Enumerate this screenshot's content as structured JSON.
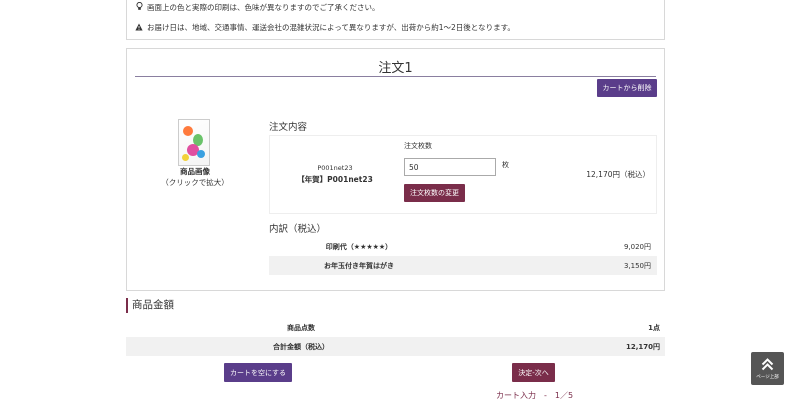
{
  "notices": [
    {
      "icon": "lightbulb-icon",
      "glyph": "💡",
      "text": "画面上の色と実際の印刷は、色味が異なりますのでご了承ください。"
    },
    {
      "icon": "warning-icon",
      "glyph": "▲",
      "text": "お届け日は、地域、交通事情、運送会社の混雑状況によって異なりますが、出荷から約1～2日後となります。"
    }
  ],
  "order": {
    "title": "注文1",
    "remove_button": "カートから削除",
    "image_caption": "商品画像",
    "image_zoom_hint": "（クリックで拡大）",
    "content_heading": "注文内容",
    "product_code": "P001net23",
    "product_name": "【年賀】P001net23",
    "quantity_label": "注文枚数",
    "quantity_value": "50",
    "quantity_unit": "枚",
    "change_quantity_button": "注文枚数の変更",
    "price": "12,170円（税込）",
    "breakdown_heading": "内訳（税込）",
    "breakdown": [
      {
        "label": "印刷代（★★★★★）",
        "value": "9,020円"
      },
      {
        "label": "お年玉付き年賀はがき",
        "value": "3,150円"
      }
    ]
  },
  "totals": {
    "heading": "商品金額",
    "rows": [
      {
        "label": "商品点数",
        "value": "1点"
      },
      {
        "label": "合計金額（税込）",
        "value": "12,170円"
      }
    ]
  },
  "actions": {
    "empty_cart_button": "カートを空にする",
    "next_button": "決定-次へ"
  },
  "progress": "カート入力　-　1／5",
  "page_top": {
    "label": "ページ上部",
    "icon": "chevron-up-icon"
  },
  "colors": {
    "accent_purple": "#5a3d8a",
    "accent_wine": "#7a2d4a",
    "page_top_bg": "#555555"
  }
}
